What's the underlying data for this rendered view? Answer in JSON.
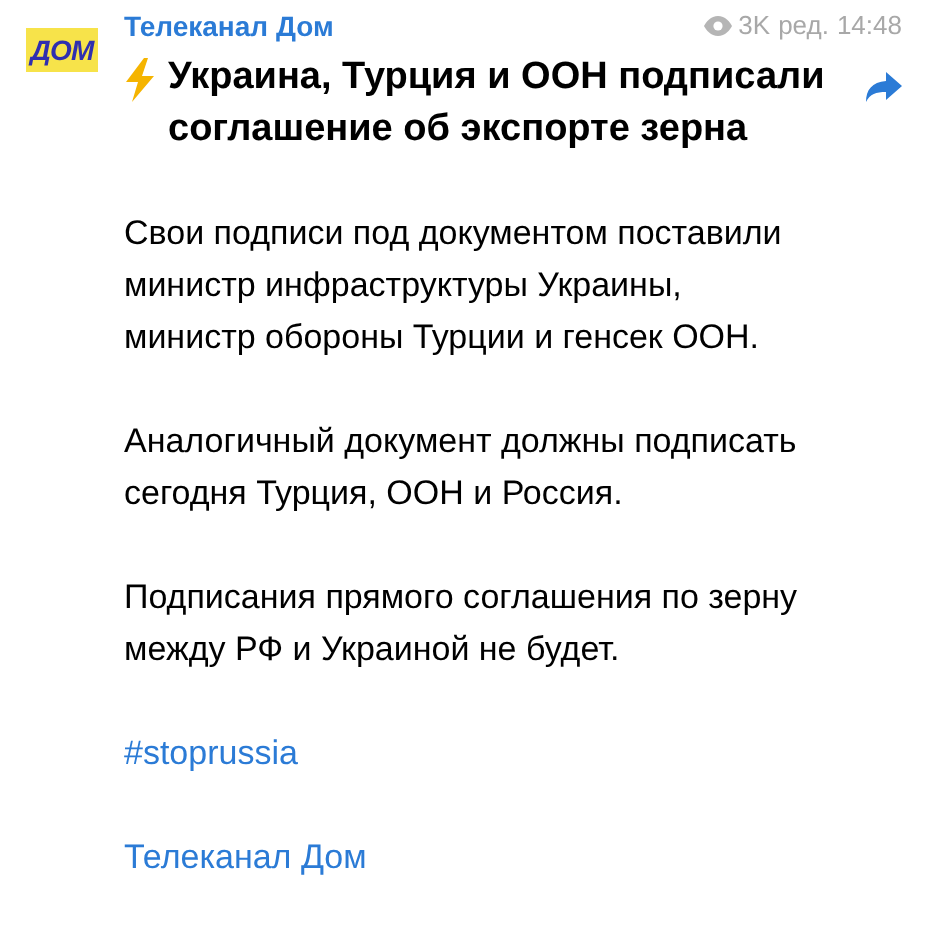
{
  "channel": {
    "logo": "ДОМ",
    "name": "Телеканал Дом",
    "views": "3K",
    "edited": "ред.",
    "time": "14:48"
  },
  "post": {
    "title": "Украина, Турция и ООН подписали соглашение об экспорте зерна",
    "paragraphs": [
      {
        "kind": "text",
        "text": "Свои подписи под документом поставили министр инфраструктуры Украины, министр обороны Турции и генсек ООН."
      },
      {
        "kind": "text",
        "text": "Аналогичный документ должны подписать сегодня Турция, ООН и Россия."
      },
      {
        "kind": "text",
        "text": "Подписания прямого соглашения по зерну между РФ и Украиной не будет."
      },
      {
        "kind": "link",
        "text": "#stoprussia"
      },
      {
        "kind": "link",
        "text": "Телеканал Дом"
      }
    ]
  }
}
